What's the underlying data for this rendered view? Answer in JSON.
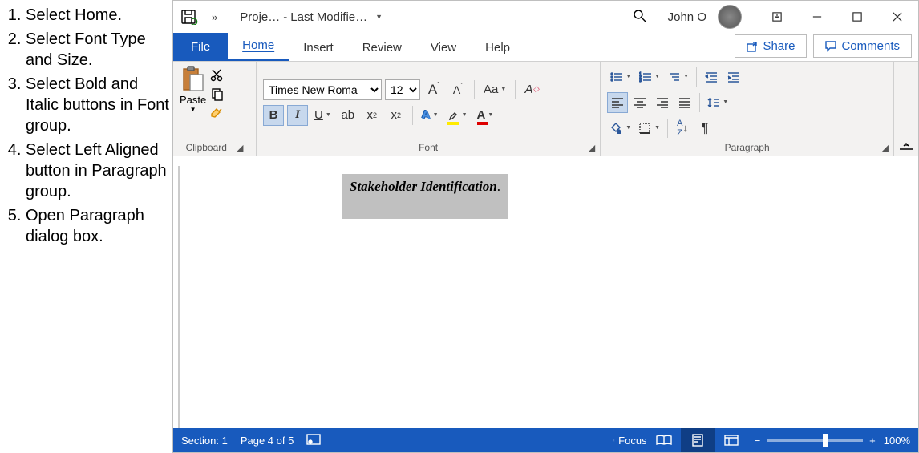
{
  "instructions": [
    "Select Home.",
    "Select Font Type and Size.",
    "Select Bold and Italic buttons in Font group.",
    "Select Left Aligned button in Paragraph group.",
    "Open Paragraph dialog box."
  ],
  "titlebar": {
    "doc_name": "Proje…",
    "sep": "-",
    "save_status": "Last Modifie…",
    "user": "John O"
  },
  "tabs": {
    "file": "File",
    "home": "Home",
    "insert": "Insert",
    "review": "Review",
    "view": "View",
    "help": "Help"
  },
  "actions": {
    "share": "Share",
    "comments": "Comments"
  },
  "ribbon": {
    "clipboard": {
      "paste": "Paste",
      "label": "Clipboard"
    },
    "font": {
      "name": "Times New Roma",
      "size": "12",
      "bold": "B",
      "italic": "I",
      "underline": "U",
      "strike": "ab",
      "subscript": "x",
      "sub_2": "2",
      "superscript": "x",
      "sup_2": "2",
      "case": "Aa",
      "grow": "A",
      "shrink": "A",
      "label": "Font"
    },
    "paragraph": {
      "label": "Paragraph"
    }
  },
  "document": {
    "heading": "Stakeholder Identification"
  },
  "status": {
    "section": "Section: 1",
    "page": "Page 4 of 5",
    "focus": "Focus",
    "zoom": "100%"
  }
}
